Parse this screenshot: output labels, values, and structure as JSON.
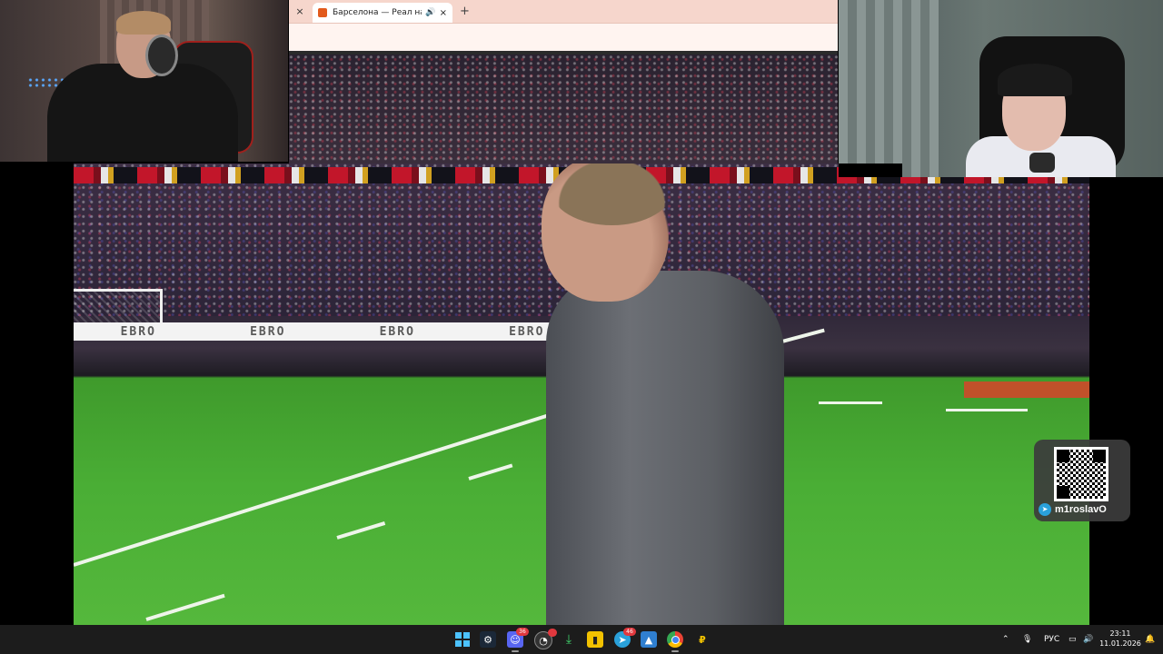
{
  "browser": {
    "tab_title": "Барселона — Реал на Кин",
    "close_label": "×",
    "tab_close_label": "×",
    "new_tab_label": "+"
  },
  "video": {
    "ad_board_text": [
      "EBRO",
      "EBRO",
      "EBRO",
      "EBRO"
    ]
  },
  "qr_overlay": {
    "handle": "m1roslavO"
  },
  "taskbar": {
    "apps": [
      {
        "name": "start",
        "icon": "windows-icon"
      },
      {
        "name": "steam",
        "icon": "steam-icon"
      },
      {
        "name": "discord",
        "icon": "discord-icon",
        "badge": "36"
      },
      {
        "name": "app-red",
        "icon": "app-icon",
        "badge": ""
      },
      {
        "name": "download",
        "icon": "download-icon"
      },
      {
        "name": "yellow-app",
        "icon": "app-icon"
      },
      {
        "name": "telegram",
        "icon": "telegram-icon",
        "badge": "46"
      },
      {
        "name": "photos",
        "icon": "photos-icon"
      },
      {
        "name": "chrome",
        "icon": "chrome-icon"
      },
      {
        "name": "app-r",
        "icon": "app-icon"
      }
    ],
    "language": "РУС",
    "time": "23:11",
    "date": "11.01.2026"
  },
  "colors": {
    "browser_tabbar": "#f6d6cc",
    "taskbar": "#1c1c1c",
    "pitch": "#4aae35",
    "telegram": "#2aa1da"
  }
}
